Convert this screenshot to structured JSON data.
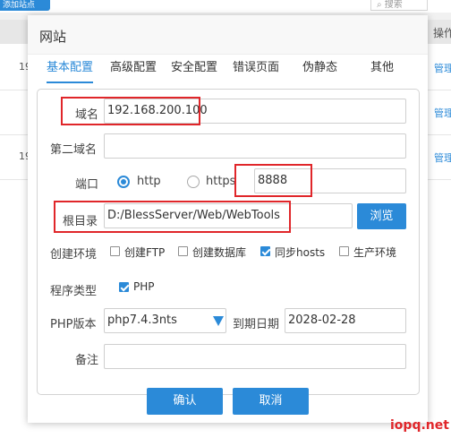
{
  "background": {
    "add_site_button": "添加站点",
    "search_placeholder": "搜索",
    "ops_column": "操作",
    "rows": [
      {
        "num": "19",
        "action": "管理"
      },
      {
        "num": "",
        "action": "管理"
      },
      {
        "num": "19",
        "action": "管理"
      }
    ]
  },
  "dialog": {
    "title": "网站",
    "tabs": [
      "基本配置",
      "高级配置",
      "安全配置",
      "错误页面",
      "伪静态",
      "其他"
    ],
    "active_tab": "基本配置",
    "form": {
      "domain": {
        "label": "域名",
        "value": "192.168.200.100"
      },
      "second_domain": {
        "label": "第二域名",
        "value": ""
      },
      "port": {
        "label": "端口",
        "options": [
          "http",
          "https"
        ],
        "selected": "http",
        "value": "8888"
      },
      "root": {
        "label": "根目录",
        "value": "D:/BlessServer/Web/WebTools",
        "browse_label": "浏览"
      },
      "env": {
        "label": "创建环境",
        "options": [
          {
            "label": "创建FTP",
            "checked": false
          },
          {
            "label": "创建数据库",
            "checked": false
          },
          {
            "label": "同步hosts",
            "checked": true
          },
          {
            "label": "生产环境",
            "checked": false
          }
        ]
      },
      "program_type": {
        "label": "程序类型",
        "option": {
          "label": "PHP",
          "checked": true
        }
      },
      "php_version": {
        "label": "PHP版本",
        "value": "php7.4.3nts"
      },
      "expire": {
        "label": "到期日期",
        "value": "2028-02-28"
      },
      "remark": {
        "label": "备注",
        "value": ""
      }
    },
    "buttons": {
      "confirm": "确认",
      "cancel": "取消"
    }
  },
  "watermark": "iopq.net",
  "colors": {
    "accent": "#2b8ad8",
    "highlight": "#e0262a"
  }
}
